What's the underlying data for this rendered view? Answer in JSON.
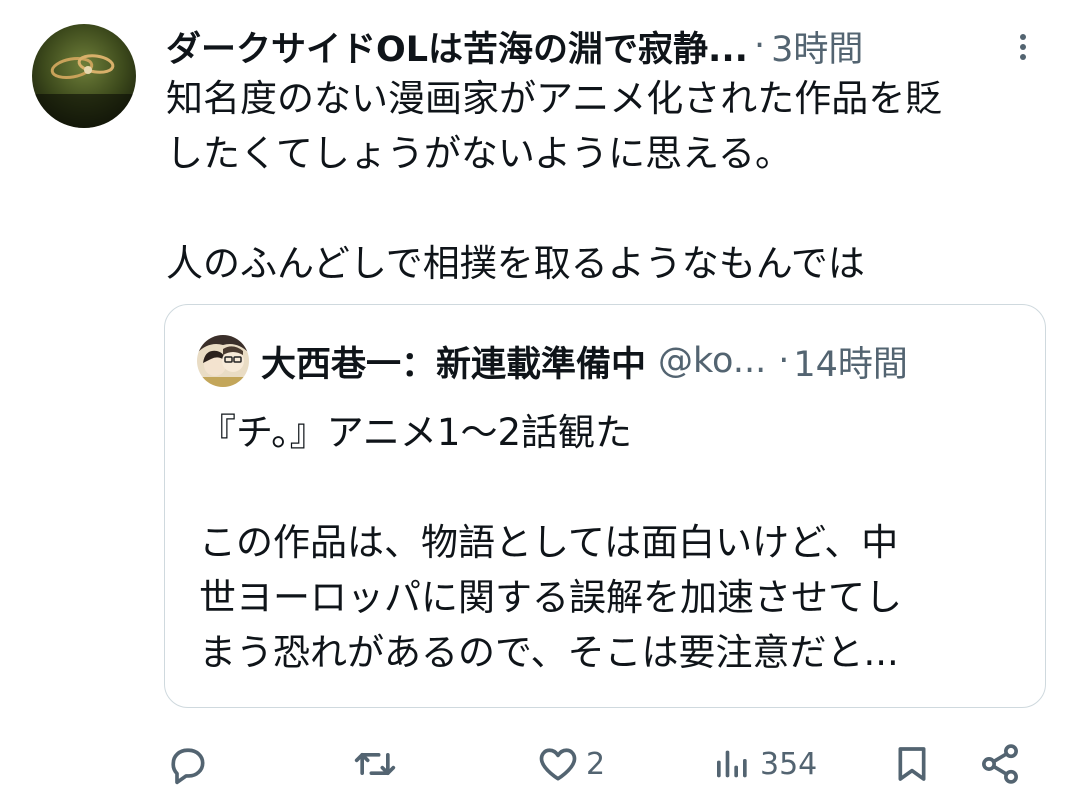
{
  "tweet": {
    "author_name": "ダークサイドOLは苦海の淵で寂静...",
    "separator": "·",
    "time": "3時間",
    "text_lines": [
      "知名度のない漫画家がアニメ化された作品を貶",
      "したくてしょうがないように思える。",
      "",
      "人のふんどしで相撲を取るようなもんでは"
    ],
    "avatar_icon": "ring-photo-avatar",
    "more_icon": "more-vertical-icon"
  },
  "quote": {
    "author_name": "大西巷一：新連載準備中",
    "handle": "@ko...",
    "separator": "·",
    "time": "14時間",
    "text_lines": [
      "『チ。』アニメ1〜2話観た",
      "",
      "この作品は、物語としては面白いけど、中",
      "世ヨーロッパに関する誤解を加速させてし",
      "まう恐れがあるので、そこは要注意だと..."
    ],
    "avatar_icon": "manga-character-avatar"
  },
  "actions": {
    "reply_count": "",
    "retweet_count": "",
    "like_count": "2",
    "views_count": "354",
    "icons": [
      "reply-icon",
      "retweet-icon",
      "like-icon",
      "views-icon",
      "bookmark-icon",
      "share-icon"
    ]
  },
  "colors": {
    "text_primary": "#0f1419",
    "text_secondary": "#536471",
    "border": "#cfd9de",
    "background": "#ffffff"
  }
}
